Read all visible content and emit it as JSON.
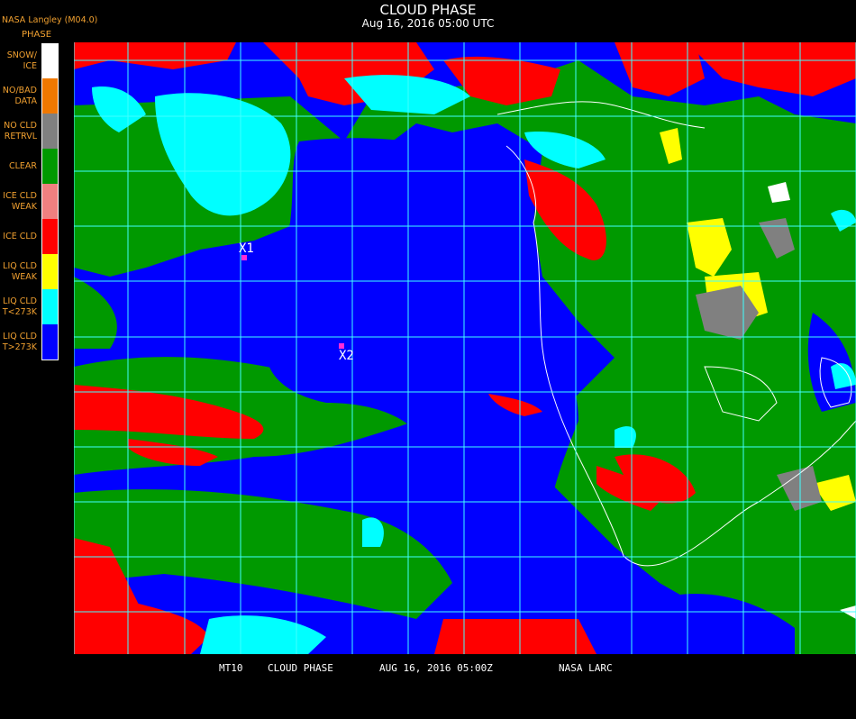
{
  "header": {
    "title": "CLOUD PHASE",
    "subtitle": "Aug 16, 2016 05:00 UTC",
    "brand": "NASA Langley (M04.0)"
  },
  "legend": {
    "title": "PHASE",
    "items": [
      {
        "label": "SNOW/\nICE",
        "color": "#ffffff"
      },
      {
        "label": "NO/BAD\nDATA",
        "color": "#f07800"
      },
      {
        "label": "NO CLD\nRETRVL",
        "color": "#808080"
      },
      {
        "label": "CLEAR",
        "color": "#009900"
      },
      {
        "label": "ICE CLD\nWEAK",
        "color": "#f08080"
      },
      {
        "label": "ICE CLD",
        "color": "#ff0000"
      },
      {
        "label": "LIQ CLD\nWEAK",
        "color": "#ffff00"
      },
      {
        "label": "LIQ CLD\nT<273K",
        "color": "#00ffff"
      },
      {
        "label": "LIQ CLD\nT>273K",
        "color": "#0000ff"
      }
    ]
  },
  "markers": [
    {
      "label": "X1"
    },
    {
      "label": "X2"
    }
  ],
  "map": {
    "grid_color": "#40ffff",
    "coast_color": "#ffffff"
  },
  "footer": {
    "sat": "MT10",
    "product": "CLOUD PHASE",
    "datetime": "AUG 16, 2016 05:00Z",
    "org": "NASA LARC"
  }
}
